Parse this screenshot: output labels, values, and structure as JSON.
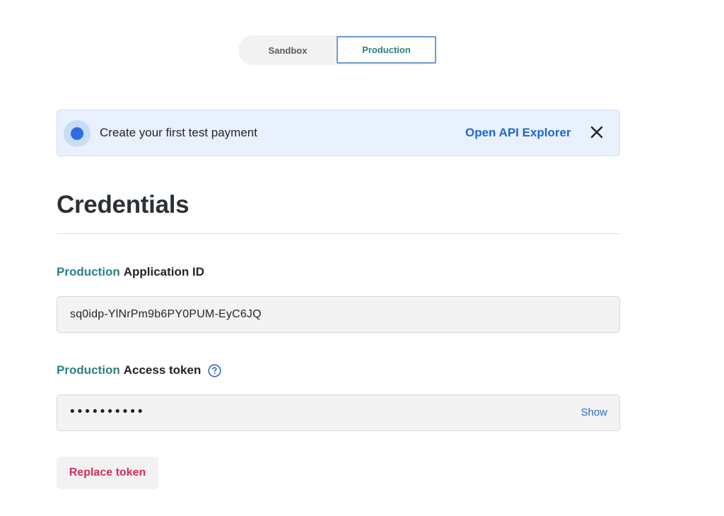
{
  "environment_toggle": {
    "options": [
      {
        "label": "Sandbox",
        "selected": false
      },
      {
        "label": "Production",
        "selected": true
      }
    ]
  },
  "banner": {
    "text": "Create your first test payment",
    "link_label": "Open API Explorer",
    "close_icon": "close-icon",
    "status_icon": "dot-icon"
  },
  "credentials": {
    "title": "Credentials",
    "application_id": {
      "env_label": "Production",
      "label": "Application ID",
      "value": "sq0idp-YlNrPm9b6PY0PUM-EyC6JQ"
    },
    "access_token": {
      "env_label": "Production",
      "label": "Access token",
      "help_icon": "help-circle-icon",
      "masked_value": "••••••••••",
      "show_label": "Show"
    },
    "replace_label": "Replace token"
  },
  "colors": {
    "accent_teal": "#2d8080",
    "link_blue": "#1f66d1",
    "danger": "#cf2f5a",
    "banner_bg": "#e8f1fd"
  }
}
